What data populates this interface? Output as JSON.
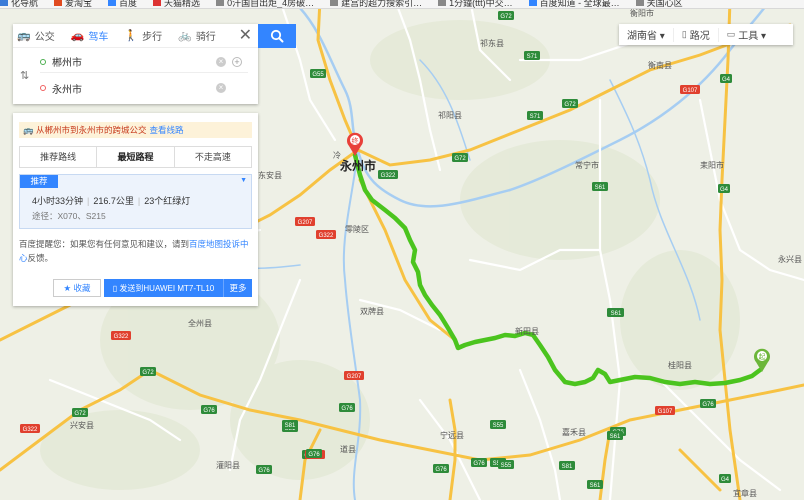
{
  "bookmarks": [
    {
      "label": "化导航",
      "color": "#3b7bd8"
    },
    {
      "label": "爱淘宝",
      "color": "#e04a1f"
    },
    {
      "label": "百度",
      "color": "#3385ff"
    },
    {
      "label": "天猫精选",
      "color": "#d33"
    },
    {
      "label": "0汗国自出炬_4房破…",
      "color": "#888"
    },
    {
      "label": "建宫的超力搜索引…",
      "color": "#888"
    },
    {
      "label": "1分鐘(ttt)中交…",
      "color": "#888"
    },
    {
      "label": "百度知道 - 全球最…",
      "color": "#3385ff"
    },
    {
      "label": "关国心区",
      "color": "#888"
    }
  ],
  "search": {
    "modes": [
      {
        "label": "公交",
        "icon": "bus-icon",
        "glyph": "🚌",
        "active": false
      },
      {
        "label": "驾车",
        "icon": "car-icon",
        "glyph": "🚗",
        "active": true
      },
      {
        "label": "步行",
        "icon": "walk-icon",
        "glyph": "🚶",
        "active": false
      },
      {
        "label": "骑行",
        "icon": "bike-icon",
        "glyph": "🚲",
        "active": false
      }
    ],
    "close": "✕",
    "swap_icon": "⇅",
    "origin": "郴州市",
    "destination": "永州市",
    "clear": "×",
    "add": "+"
  },
  "toolbar": {
    "region": "湖南省 ▾",
    "traffic": "路况",
    "tools": "工具 ▾"
  },
  "result": {
    "bus_tip": "从郴州市到永州市的跨城公交",
    "bus_tip_link": "查看线路",
    "plan_tabs": [
      {
        "label": "推荐路线",
        "active": false
      },
      {
        "label": "最短路程",
        "active": true
      },
      {
        "label": "不走高速",
        "active": false
      }
    ],
    "recommend_badge": "推荐",
    "duration": "4小时33分钟",
    "distance": "216.7公里",
    "lights": "23个红绿灯",
    "via": "途径：X070、S215",
    "notice_prefix": "百度提醒您：如果您有任何意见和建议，请到",
    "notice_link": "百度地图投诉中心",
    "notice_suffix": "反馈。",
    "favorite": "收藏",
    "send": "发送到HUAWEI MT7-TL10",
    "more": "更多"
  },
  "map": {
    "route_color": "#4bc41e",
    "highway_color": "#f7c243",
    "road_color": "#ffffff",
    "water_color": "#a6cdf2",
    "start_marker": "起",
    "end_marker": "终",
    "cities": [
      {
        "name": "永州市",
        "bold": true
      },
      {
        "name": "冷"
      },
      {
        "name": "衡阳市"
      },
      {
        "name": "祁东县"
      },
      {
        "name": "祁阳县"
      },
      {
        "name": "常宁市"
      },
      {
        "name": "衡南县"
      },
      {
        "name": "耒阳市"
      },
      {
        "name": "东安县"
      },
      {
        "name": "零陵区"
      },
      {
        "name": "双牌县"
      },
      {
        "name": "新田县"
      },
      {
        "name": "桂阳县"
      },
      {
        "name": "宁远县"
      },
      {
        "name": "嘉禾县"
      },
      {
        "name": "全州县"
      },
      {
        "name": "兴安县"
      },
      {
        "name": "道县"
      },
      {
        "name": "灌阳县"
      },
      {
        "name": "永兴县"
      },
      {
        "name": "宜章县"
      }
    ],
    "shields": [
      {
        "label": "G55",
        "type": "g"
      },
      {
        "label": "S71",
        "type": "s"
      },
      {
        "label": "G72",
        "type": "g"
      },
      {
        "label": "S71",
        "type": "s"
      },
      {
        "label": "G72",
        "type": "g"
      },
      {
        "label": "G322",
        "type": "g"
      },
      {
        "label": "G207",
        "type": "r"
      },
      {
        "label": "G322",
        "type": "r"
      },
      {
        "label": "S61",
        "type": "s"
      },
      {
        "label": "G4",
        "type": "g"
      },
      {
        "label": "G107",
        "type": "r"
      },
      {
        "label": "G4",
        "type": "g"
      },
      {
        "label": "G72",
        "type": "g"
      },
      {
        "label": "S61",
        "type": "s"
      },
      {
        "label": "G322",
        "type": "r"
      },
      {
        "label": "G72",
        "type": "g"
      },
      {
        "label": "G207",
        "type": "r"
      },
      {
        "label": "G76",
        "type": "g"
      },
      {
        "label": "G76",
        "type": "g"
      },
      {
        "label": "S81",
        "type": "s"
      },
      {
        "label": "G72",
        "type": "g"
      },
      {
        "label": "G322",
        "type": "r"
      },
      {
        "label": "G76",
        "type": "g"
      },
      {
        "label": "G76",
        "type": "g"
      },
      {
        "label": "G76",
        "type": "g"
      },
      {
        "label": "S55",
        "type": "s"
      },
      {
        "label": "G107",
        "type": "r"
      },
      {
        "label": "S81",
        "type": "s"
      },
      {
        "label": "G76",
        "type": "g"
      },
      {
        "label": "G76",
        "type": "g"
      },
      {
        "label": "S55",
        "type": "s"
      },
      {
        "label": "G207",
        "type": "r"
      },
      {
        "label": "G4",
        "type": "g"
      },
      {
        "label": "S61",
        "type": "s"
      },
      {
        "label": "S61",
        "type": "s"
      },
      {
        "label": "G76",
        "type": "g"
      },
      {
        "label": "S55",
        "type": "s"
      },
      {
        "label": "S61",
        "type": "s"
      },
      {
        "label": "G76",
        "type": "g"
      },
      {
        "label": "S81",
        "type": "s"
      }
    ]
  }
}
